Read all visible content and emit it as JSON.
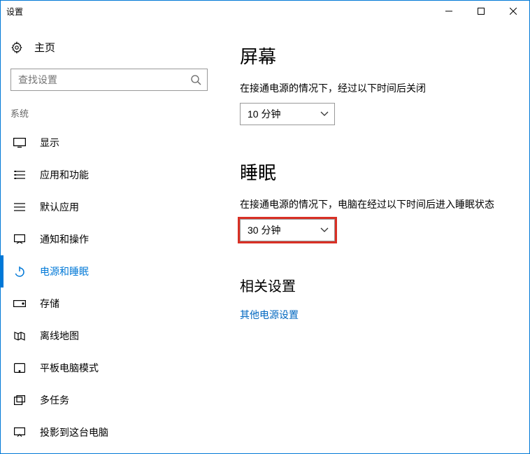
{
  "window": {
    "title": "设置"
  },
  "sidebar": {
    "home_label": "主页",
    "search_placeholder": "查找设置",
    "section": "系统",
    "items": [
      {
        "label": "显示"
      },
      {
        "label": "应用和功能"
      },
      {
        "label": "默认应用"
      },
      {
        "label": "通知和操作"
      },
      {
        "label": "电源和睡眠"
      },
      {
        "label": "存储"
      },
      {
        "label": "离线地图"
      },
      {
        "label": "平板电脑模式"
      },
      {
        "label": "多任务"
      },
      {
        "label": "投影到这台电脑"
      }
    ]
  },
  "main": {
    "screen": {
      "heading": "屏幕",
      "desc": "在接通电源的情况下，经过以下时间后关闭",
      "value": "10 分钟"
    },
    "sleep": {
      "heading": "睡眠",
      "desc": "在接通电源的情况下，电脑在经过以下时间后进入睡眠状态",
      "value": "30 分钟"
    },
    "related": {
      "heading": "相关设置",
      "link": "其他电源设置"
    }
  }
}
